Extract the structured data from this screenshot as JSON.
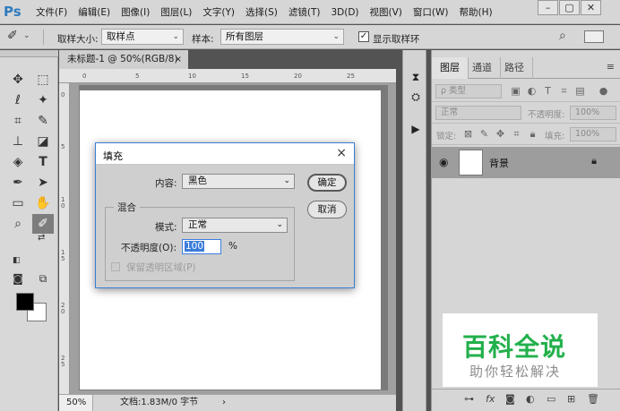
{
  "menubar": {
    "logo": "Ps",
    "items": [
      "文件(F)",
      "编辑(E)",
      "图像(I)",
      "图层(L)",
      "文字(Y)",
      "选择(S)",
      "滤镜(T)",
      "3D(D)",
      "视图(V)",
      "窗口(W)",
      "帮助(H)"
    ],
    "window_controls": [
      "minimize-icon",
      "restore-icon",
      "close-icon"
    ]
  },
  "options": {
    "sample_size_label": "取样大小:",
    "sample_size_value": "取样点",
    "sample_label": "样本:",
    "sample_value": "所有图层",
    "show_ring_label": "显示取样环",
    "show_ring_checked": true
  },
  "document": {
    "tab_title": "未标题-1 @ 50%(RGB/8)",
    "tab_close": "×",
    "ruler_h_ticks": [
      "0",
      "5",
      "10",
      "15",
      "20",
      "25"
    ],
    "ruler_v_ticks": [
      "0",
      "5",
      "1 0",
      "1 5",
      "2 0",
      "2 5"
    ],
    "zoom": "50%",
    "doc_info": "文档:1.83M/0 字节",
    "status_arrow": "›"
  },
  "dialog": {
    "title": "填充",
    "close": "×",
    "content_label": "内容:",
    "content_value": "黑色",
    "ok_label": "确定",
    "cancel_label": "取消",
    "blend_group_label": "混合",
    "mode_label": "模式:",
    "mode_value": "正常",
    "opacity_label": "不透明度(O):",
    "opacity_value": "100",
    "opacity_unit": "%",
    "preserve_label": "保留透明区域(P)",
    "preserve_checked": false
  },
  "layers_panel": {
    "tabs": [
      "图层",
      "通道",
      "路径"
    ],
    "active_tab": "图层",
    "filter_placeholder": "ρ 类型",
    "blend_mode": "正常",
    "opacity_label": "不透明度:",
    "opacity_value": "100%",
    "lock_label": "锁定:",
    "fill_label": "填充:",
    "fill_value": "100%",
    "layer_name": "背景"
  },
  "watermark": {
    "title": "百科全说",
    "subtitle": "助你轻松解决"
  },
  "colors": {
    "foreground": "#000000",
    "background": "#ffffff",
    "accent": "#3c7ddb",
    "watermark_green": "#22b04b"
  }
}
